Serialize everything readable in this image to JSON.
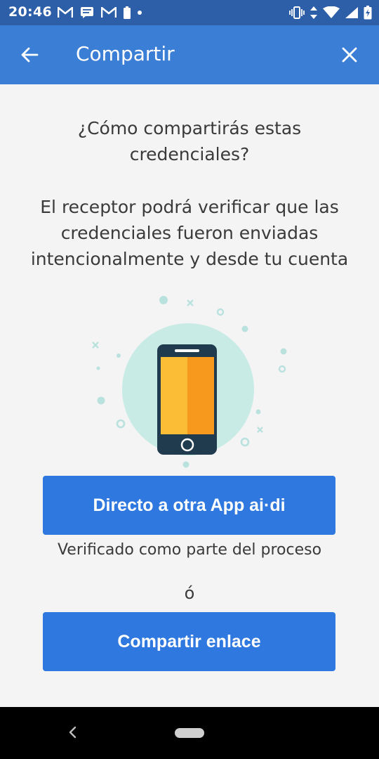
{
  "status_bar": {
    "time": "20:46",
    "left_icons": [
      "gmail-icon",
      "message-icon",
      "gmail-icon",
      "battery-saver-icon",
      "notification-dot-icon"
    ],
    "right_icons": [
      "vibrate-icon",
      "data-transfer-icon",
      "wifi-icon",
      "signal-icon",
      "battery-charging-icon"
    ]
  },
  "app_bar": {
    "title": "Compartir",
    "back_icon": "arrow-left-icon",
    "close_icon": "close-icon"
  },
  "main": {
    "question": "¿Cómo compartirás estas credenciales?",
    "description": "El receptor podrá verificar que las credenciales fueron enviadas intencionalmente y desde tu cuenta",
    "illustration": "smartphone-illustration",
    "direct_button_label": "Directo a otra App ai·di",
    "verified_note": "Verificado como parte del proceso",
    "or_label": "ó",
    "share_link_button_label": "Compartir enlace"
  },
  "nav_bar": {
    "back_icon": "chevron-left-icon",
    "home_icon": "home-pill-icon"
  },
  "colors": {
    "status_bar": "#2c5fa8",
    "app_bar": "#3b7ed6",
    "button": "#2f78df",
    "background": "#f4f4f4",
    "text": "#3a3a3a",
    "illustration_circle": "#c9ebe6",
    "phone_body": "#1f3b4d",
    "screen_left": "#fbbd36",
    "screen_right": "#f7991c",
    "decoration": "#b9e2df"
  }
}
